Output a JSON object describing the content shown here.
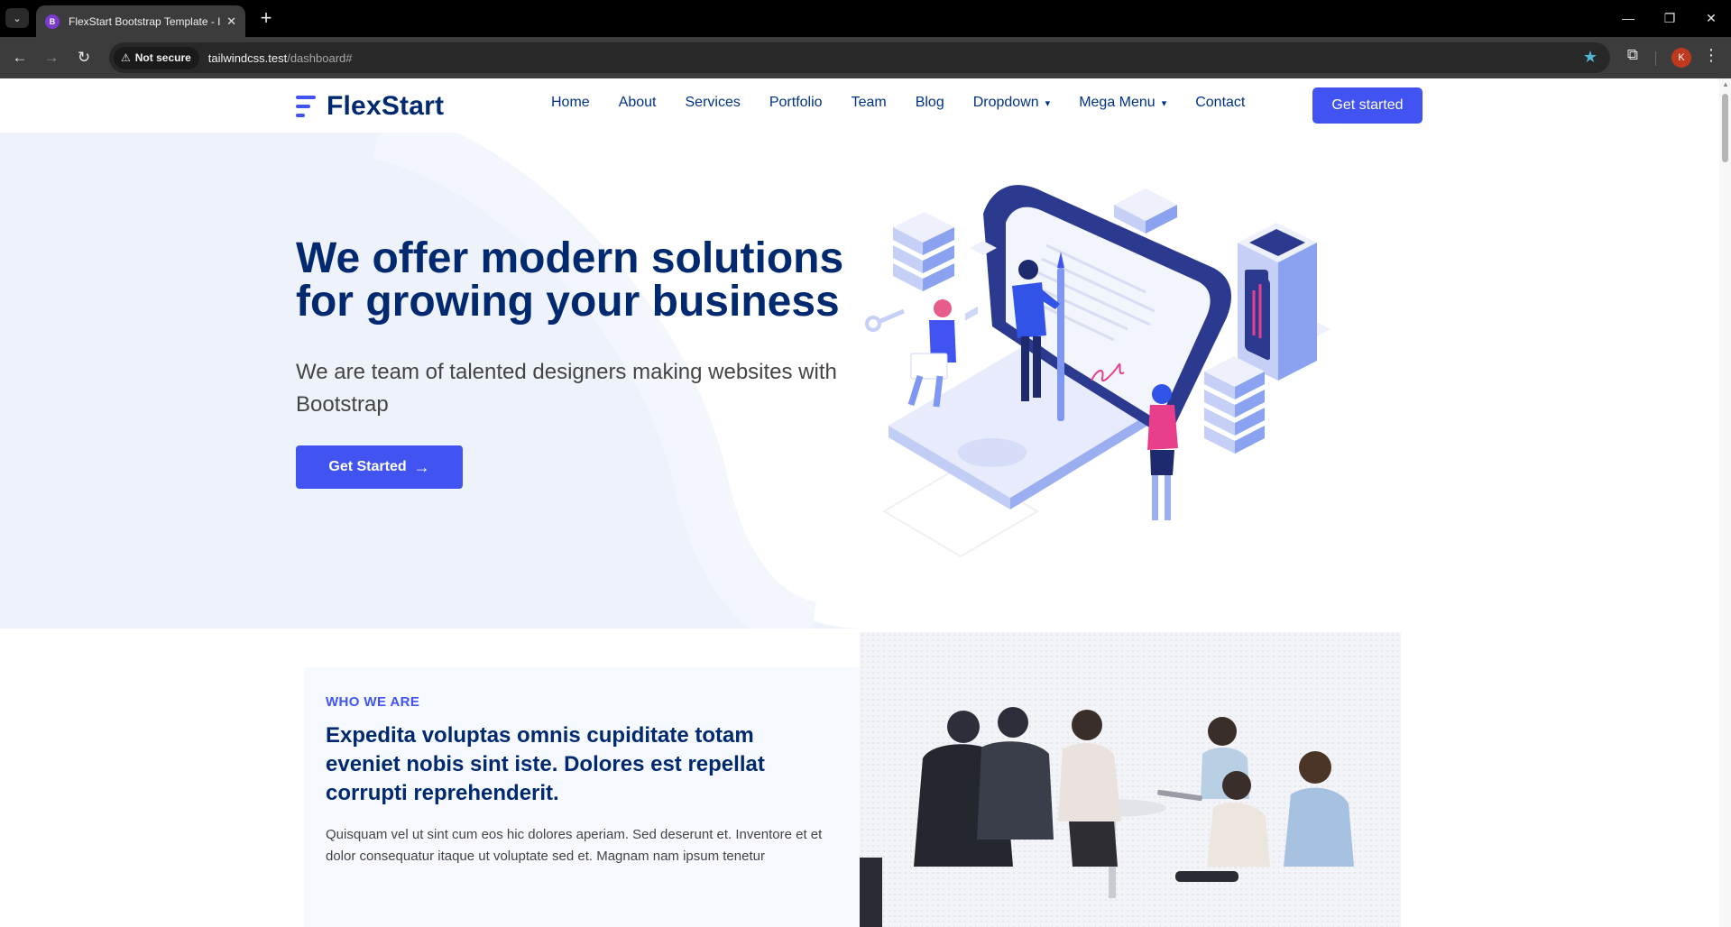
{
  "browser": {
    "tab": {
      "favicon_letter": "B",
      "title": "FlexStart Bootstrap Template - I",
      "close": "✕"
    },
    "new_tab": "+",
    "security_label": "Not secure",
    "url_host": "tailwindcss.test",
    "url_path": "/dashboard#",
    "profile_initial": "K",
    "window_controls": {
      "minimize": "—",
      "restore": "❐",
      "close": "✕"
    }
  },
  "site": {
    "logo_text": "FlexStart",
    "brand_colors": {
      "primary": "#4154f1",
      "heading": "#012970",
      "nav": "#013289"
    },
    "nav": [
      {
        "label": "Home",
        "caret": false
      },
      {
        "label": "About",
        "caret": false
      },
      {
        "label": "Services",
        "caret": false
      },
      {
        "label": "Portfolio",
        "caret": false
      },
      {
        "label": "Team",
        "caret": false
      },
      {
        "label": "Blog",
        "caret": false
      },
      {
        "label": "Dropdown",
        "caret": true
      },
      {
        "label": "Mega Menu",
        "caret": true
      },
      {
        "label": "Contact",
        "caret": false
      }
    ],
    "nav_caret": "⌄",
    "header_cta": "Get started"
  },
  "hero": {
    "title_line1": "We offer modern solutions",
    "title_line2": "for growing your business",
    "subtitle": "We are team of talented designers making websites with Bootstrap",
    "button_label": "Get Started",
    "button_arrow": "→"
  },
  "about": {
    "eyebrow": "WHO WE ARE",
    "heading": "Expedita voluptas omnis cupiditate totam eveniet nobis sint iste. Dolores est repellat corrupti reprehenderit.",
    "text": "Quisquam vel ut sint cum eos hic dolores aperiam. Sed deserunt et. Inventore et et dolor consequatur itaque ut voluptate sed et. Magnam nam ipsum tenetur"
  }
}
